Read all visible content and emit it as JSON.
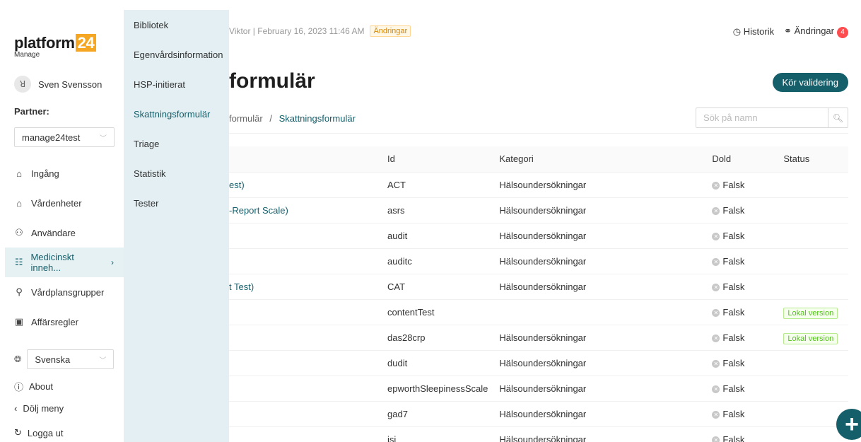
{
  "app": {
    "logo_text": "platform",
    "logo_num": "24",
    "logo_sub": "Manage"
  },
  "user": {
    "name": "Sven Svensson",
    "avatar_icon": "user-icon"
  },
  "partner": {
    "label": "Partner:",
    "value": "manage24test"
  },
  "nav": [
    {
      "label": "Ingång",
      "icon": "⌂"
    },
    {
      "label": "Vårdenheter",
      "icon": "⌂"
    },
    {
      "label": "Användare",
      "icon": "⚇"
    },
    {
      "label": "Medicinskt inneh...",
      "icon": "☷",
      "active": true
    },
    {
      "label": "Vårdplansgrupper",
      "icon": "⚲"
    },
    {
      "label": "Affärsregler",
      "icon": "▣"
    }
  ],
  "language": {
    "value": "Svenska"
  },
  "bottom": {
    "about": "About",
    "hide_menu": "Dölj meny",
    "logout": "Logga ut"
  },
  "submenu": [
    "Bibliotek",
    "Egenvårdsinformation",
    "HSP-initierat",
    "Skattningsformulär",
    "Triage",
    "Statistik",
    "Tester"
  ],
  "header": {
    "meta": "Viktor | February 16, 2023 11:46 AM",
    "changes_tag": "Ändringar",
    "history": "Historik",
    "changes": "Ändringar",
    "changes_count": "4",
    "title": "formulär",
    "validate_button": "Kör validering"
  },
  "breadcrumb": {
    "parent": "formulär",
    "sep": "/",
    "current": "Skattningsformulär"
  },
  "search": {
    "placeholder": "Sök på namn"
  },
  "table": {
    "headers": {
      "id": "Id",
      "kategori": "Kategori",
      "dold": "Dold",
      "status": "Status"
    },
    "rows": [
      {
        "name": "est)",
        "id": "ACT",
        "kategori": "Hälsoundersökningar",
        "dold": "Falsk",
        "status": ""
      },
      {
        "name": "-Report Scale)",
        "id": "asrs",
        "kategori": "Hälsoundersökningar",
        "dold": "Falsk",
        "status": ""
      },
      {
        "name": "",
        "id": "audit",
        "kategori": "Hälsoundersökningar",
        "dold": "Falsk",
        "status": ""
      },
      {
        "name": "",
        "id": "auditc",
        "kategori": "Hälsoundersökningar",
        "dold": "Falsk",
        "status": ""
      },
      {
        "name": "t Test)",
        "id": "CAT",
        "kategori": "Hälsoundersökningar",
        "dold": "Falsk",
        "status": ""
      },
      {
        "name": "",
        "id": "contentTest",
        "kategori": "",
        "dold": "Falsk",
        "status": "Lokal version"
      },
      {
        "name": "",
        "id": "das28crp",
        "kategori": "Hälsoundersökningar",
        "dold": "Falsk",
        "status": "Lokal version"
      },
      {
        "name": "",
        "id": "dudit",
        "kategori": "Hälsoundersökningar",
        "dold": "Falsk",
        "status": ""
      },
      {
        "name": "",
        "id": "epworthSleepinessScale",
        "kategori": "Hälsoundersökningar",
        "dold": "Falsk",
        "status": ""
      },
      {
        "name": "",
        "id": "gad7",
        "kategori": "Hälsoundersökningar",
        "dold": "Falsk",
        "status": ""
      },
      {
        "name": "",
        "id": "isi",
        "kategori": "Hälsoundersökningar",
        "dold": "Falsk",
        "status": ""
      }
    ]
  },
  "fab": {
    "label": "+"
  }
}
